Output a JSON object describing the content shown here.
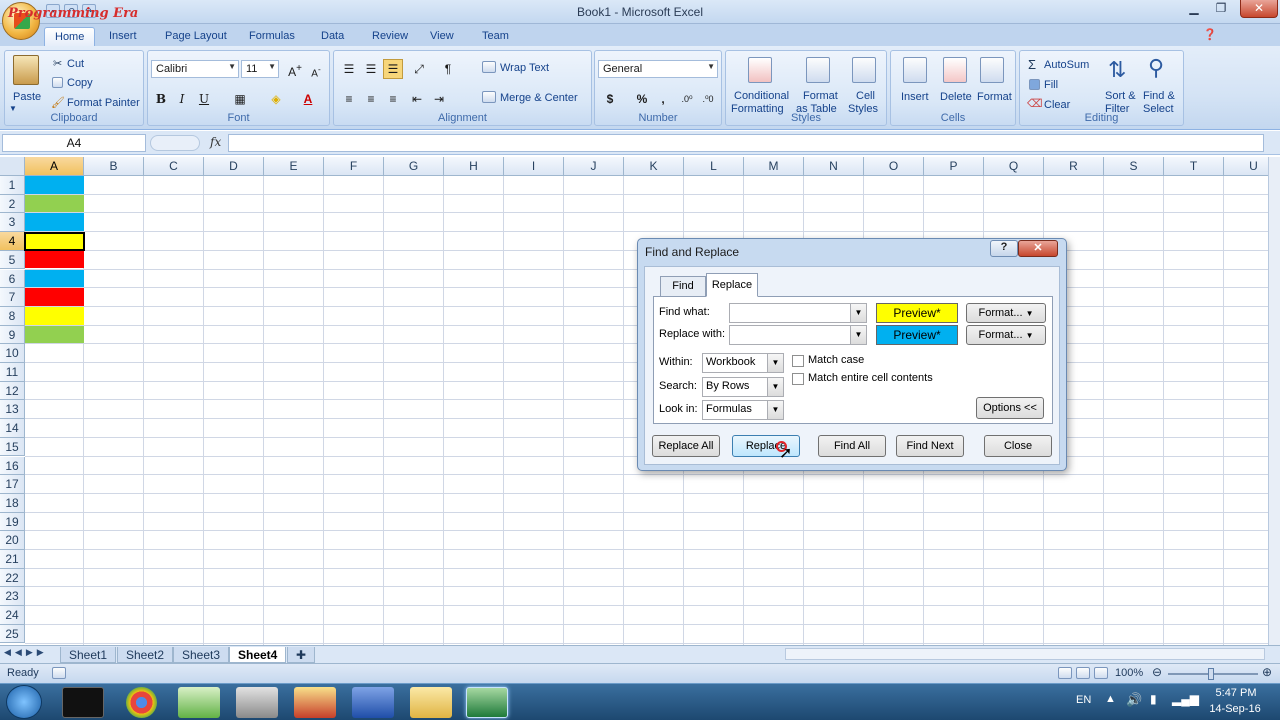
{
  "window": {
    "title": "Book1 - Microsoft Excel",
    "watermark": "Programming Era"
  },
  "ribbon_tabs": [
    "Home",
    "Insert",
    "Page Layout",
    "Formulas",
    "Data",
    "Review",
    "View",
    "Team"
  ],
  "ribbon": {
    "clipboard": {
      "paste": "Paste",
      "cut": "Cut",
      "copy": "Copy",
      "format_painter": "Format Painter",
      "label": "Clipboard"
    },
    "font": {
      "name": "Calibri",
      "size": "11",
      "bold": "B",
      "italic": "I",
      "underline": "U",
      "label": "Font"
    },
    "alignment": {
      "wrap_text": "Wrap Text",
      "merge_center": "Merge & Center",
      "label": "Alignment"
    },
    "number": {
      "format": "General",
      "currency": "$",
      "percent": "%",
      "comma": ",",
      "label": "Number"
    },
    "styles": {
      "conditional": "Conditional",
      "conditional2": "Formatting",
      "format_table": "Format",
      "format_table2": "as Table",
      "cell_styles": "Cell",
      "cell_styles2": "Styles",
      "label": "Styles"
    },
    "cells": {
      "insert": "Insert",
      "delete": "Delete",
      "format": "Format",
      "label": "Cells"
    },
    "editing": {
      "autosum": "AutoSum",
      "fill": "Fill",
      "clear": "Clear",
      "sort": "Sort &",
      "sort2": "Filter",
      "find": "Find &",
      "find2": "Select",
      "label": "Editing"
    }
  },
  "formula_bar": {
    "name_box": "A4",
    "fx": "fx",
    "value": ""
  },
  "columns": [
    "A",
    "B",
    "C",
    "D",
    "E",
    "F",
    "G",
    "H",
    "I",
    "J",
    "K",
    "L",
    "M",
    "N",
    "O",
    "P",
    "Q",
    "R",
    "S",
    "T",
    "U"
  ],
  "rows": [
    "1",
    "2",
    "3",
    "4",
    "5",
    "6",
    "7",
    "8",
    "9",
    "10",
    "11",
    "12",
    "13",
    "14",
    "15",
    "16",
    "17",
    "18",
    "19",
    "20",
    "21",
    "22",
    "23",
    "24",
    "25"
  ],
  "cell_colors": [
    "#00b0f0",
    "#92d050",
    "#00b0f0",
    "#ffff00",
    "#ff0000",
    "#00b0f0",
    "#ff0000",
    "#ffff00",
    "#92d050"
  ],
  "sheet_tabs": [
    "Sheet1",
    "Sheet2",
    "Sheet3",
    "Sheet4"
  ],
  "active_sheet": "Sheet4",
  "status": {
    "ready": "Ready",
    "zoom": "100%"
  },
  "taskbar": {
    "lang": "EN",
    "time": "5:47 PM",
    "date": "14-Sep-16"
  },
  "dialog": {
    "title": "Find and Replace",
    "help": "?",
    "tabs": [
      "Find",
      "Replace"
    ],
    "active_tab": "Replace",
    "find_what_label": "Find what:",
    "find_what_value": "",
    "replace_with_label": "Replace with:",
    "replace_with_value": "",
    "preview1": "Preview*",
    "preview1_color": "#ffff00",
    "preview2": "Preview*",
    "preview2_color": "#00b0f0",
    "format_btn": "Format...",
    "within_label": "Within:",
    "within_value": "Workbook",
    "search_label": "Search:",
    "search_value": "By Rows",
    "lookin_label": "Look in:",
    "lookin_value": "Formulas",
    "match_case": "Match case",
    "match_entire": "Match entire cell contents",
    "options": "Options <<",
    "replace_all": "Replace All",
    "replace": "Replace",
    "find_all": "Find All",
    "find_next": "Find Next",
    "close": "Close"
  }
}
